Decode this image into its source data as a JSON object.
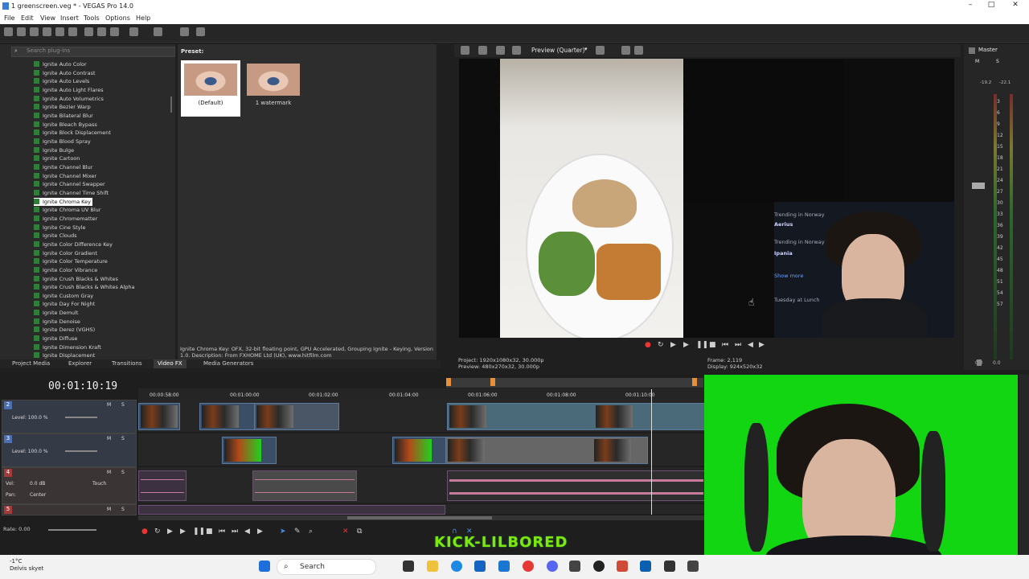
{
  "window": {
    "title": "1 greenscreen.veg * - VEGAS Pro 14.0"
  },
  "menu": [
    "File",
    "Edit",
    "View",
    "Insert",
    "Tools",
    "Options",
    "Help"
  ],
  "fx_browser": {
    "search_placeholder": "Search plug-ins",
    "items": [
      "Ignite Auto Color",
      "Ignite Auto Contrast",
      "Ignite Auto Levels",
      "Ignite Auto Light Flares",
      "Ignite Auto Volumetrics",
      "Ignite Bezier Warp",
      "Ignite Bilateral Blur",
      "Ignite Bleach Bypass",
      "Ignite Block Displacement",
      "Ignite Blood Spray",
      "Ignite Bulge",
      "Ignite Cartoon",
      "Ignite Channel Blur",
      "Ignite Channel Mixer",
      "Ignite Channel Swapper",
      "Ignite Channel Time Shift",
      "Ignite Chroma Key",
      "Ignite Chroma UV Blur",
      "Ignite Chromematter",
      "Ignite Cine Style",
      "Ignite Clouds",
      "Ignite Color Difference Key",
      "Ignite Color Gradient",
      "Ignite Color Temperature",
      "Ignite Color Vibrance",
      "Ignite Crush Blacks & Whites",
      "Ignite Crush Blacks & Whites Alpha",
      "Ignite Custom Gray",
      "Ignite Day For Night",
      "Ignite Demult",
      "Ignite Denoise",
      "Ignite Derez (VGHS)",
      "Ignite Diffuse",
      "Ignite Dimension Kraft",
      "Ignite Displacement"
    ],
    "selected_index": 16
  },
  "presets": {
    "heading": "Preset:",
    "items": [
      "(Default)",
      "1 watermark"
    ],
    "description": "Ignite Chroma Key: OFX, 32-bit floating point, GPU Accelerated, Grouping Ignite - Keying, Version 1.0. Description: From FXHOME Ltd (UK), www.hitfilm.com"
  },
  "panel_tabs": [
    "Project Media",
    "Explorer",
    "Transitions",
    "Video FX",
    "Media Generators"
  ],
  "active_panel_tab": "Video FX",
  "preview": {
    "mode": "Preview (Quarter)",
    "project": "Project: 1920x1080x32, 30.000p",
    "preview": "Preview: 480x270x32, 30.000p",
    "frame": "Frame: 2,119",
    "display": "Display: 924x520x32",
    "stream_ui": [
      "Trending in Norway",
      "Aerius",
      "Trending in Norway",
      "Ipania",
      "Show more",
      "Tuesday at Lunch"
    ]
  },
  "master": {
    "title": "Master",
    "ticks": [
      "3",
      "6",
      "9",
      "12",
      "15",
      "18",
      "21",
      "24",
      "27",
      "30",
      "33",
      "36",
      "39",
      "42",
      "45",
      "48",
      "51",
      "54",
      "57"
    ],
    "peak_l": "-19.2",
    "peak_r": "-22.1",
    "bottom_l": "0.0",
    "bottom_r": "0.0"
  },
  "timeline": {
    "timecode": "00:01:10:19",
    "ruler": [
      "00:00:58:00",
      "00:01:00:00",
      "00:01:02:00",
      "00:01:04:00",
      "00:01:06:00",
      "00:01:08:00",
      "00:01:10:00"
    ],
    "tracks": [
      {
        "num": "2",
        "type": "video",
        "level": "Level: 100.0 %"
      },
      {
        "num": "3",
        "type": "video",
        "level": "Level: 100.0 %"
      },
      {
        "num": "4",
        "type": "audio",
        "vol": "Vol:",
        "vol_val": "0.0 dB",
        "touch": "Touch",
        "pan": "Pan:",
        "pan_val": "Center"
      },
      {
        "num": "5",
        "type": "audio"
      }
    ],
    "rate": "Rate: 0.00"
  },
  "overlay": {
    "kick": "KICK-LILBORED"
  },
  "taskbar": {
    "weather_temp": "-1°C",
    "weather_desc": "Delvis skyet",
    "search": "Search"
  },
  "colors": {
    "greenscreen": "#11d611",
    "accent_blue": "#4b6fb0",
    "audio_red": "#a43b3b"
  }
}
